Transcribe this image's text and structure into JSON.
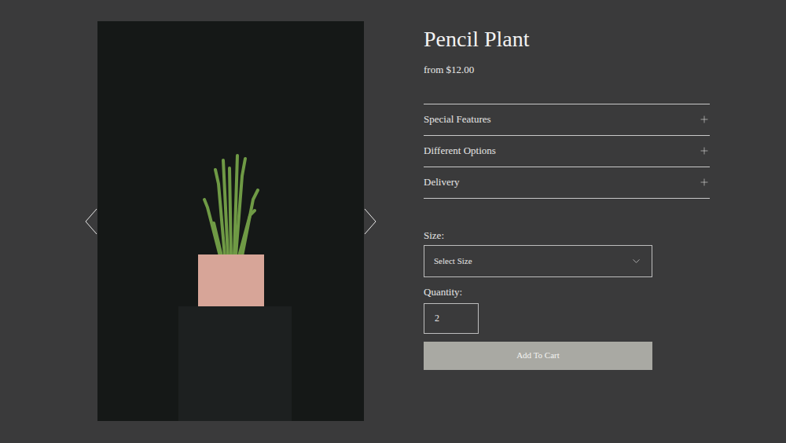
{
  "product": {
    "title": "Pencil Plant",
    "price": "from $12.00"
  },
  "accordion": [
    {
      "label": "Special Features",
      "expanded": false
    },
    {
      "label": "Different Options",
      "expanded": false
    },
    {
      "label": "Delivery",
      "expanded": false
    }
  ],
  "size": {
    "label": "Size:",
    "placeholder": "Select Size"
  },
  "quantity": {
    "label": "Quantity:",
    "value": "2"
  },
  "add_to_cart": {
    "label": "Add To Cart"
  }
}
